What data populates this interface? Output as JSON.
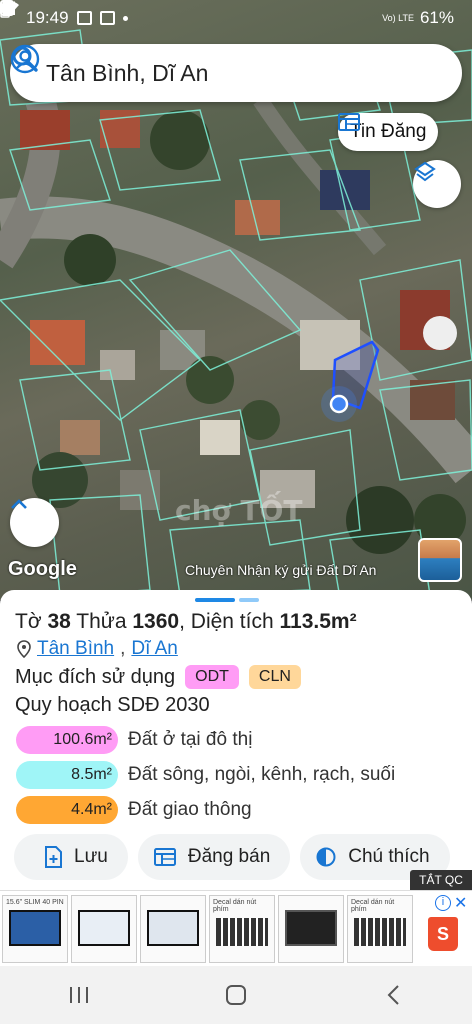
{
  "status_bar": {
    "time": "19:49",
    "battery": "61%",
    "network_label": "Vo) LTE"
  },
  "search": {
    "query": "Tân Bình, Dĩ An"
  },
  "map": {
    "tin_dang_label": "Tin Đăng",
    "google_label": "Google",
    "credit": "Chuyên Nhận ký gửi Đất Dĩ An"
  },
  "parcel": {
    "sheet_label": "Tờ",
    "sheet_no": "38",
    "plot_label": "Thửa",
    "plot_no": "1360",
    "area_label": "Diện tích",
    "area": "113.5m²",
    "ward": "Tân Bình",
    "district": "Dĩ An",
    "separator": ",",
    "purpose_label": "Mục đích sử dụng",
    "purpose_tags": [
      "ODT",
      "CLN"
    ],
    "plan_title": "Quy hoạch SDĐ 2030",
    "areas": [
      {
        "amount": "100.6m²",
        "desc": "Đất ở tại đô thị",
        "color": "#ff9cf5"
      },
      {
        "amount": "8.5m²",
        "desc": "Đất sông, ngòi, kênh, rạch, suối",
        "color": "#9ff5f7"
      },
      {
        "amount": "4.4m²",
        "desc": "Đất giao thông",
        "color": "#ffa733"
      }
    ]
  },
  "actions": {
    "save": "Lưu",
    "post": "Đăng bán",
    "legend": "Chú thích"
  },
  "ad": {
    "badge": "TẮT QC",
    "thumb1": "15.6\" SLIM 40 PIN",
    "thumb4": "Decal dán nút phím",
    "thumb6": "Decal dán nút phím",
    "shopee_letter": "S"
  },
  "colors": {
    "accent": "#1976d2",
    "parcel_outline": "#7ef2da"
  }
}
